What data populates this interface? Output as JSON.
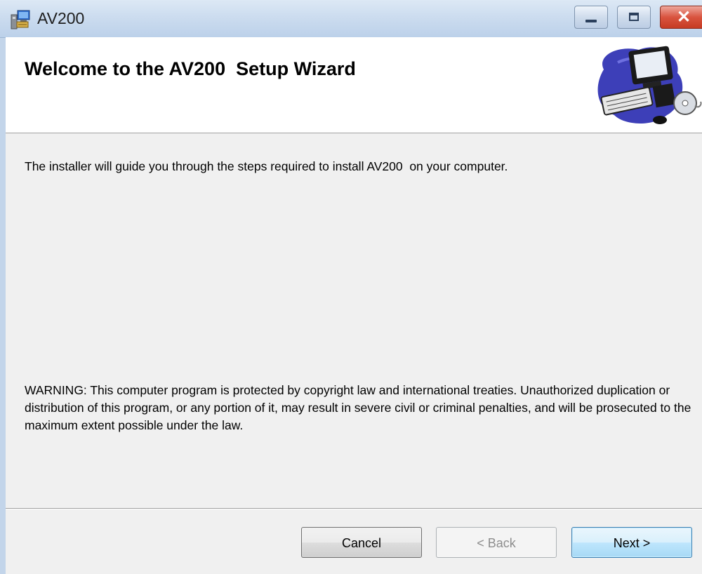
{
  "window": {
    "title": "AV200"
  },
  "title_controls": {
    "minimize": "minimize",
    "maximize": "maximize",
    "close": "close"
  },
  "banner": {
    "heading": "Welcome to the AV200  Setup Wizard"
  },
  "content": {
    "intro": "The installer will guide you through the steps required to install AV200  on your computer.",
    "warning": "WARNING: This computer program is protected by copyright law and international treaties. Unauthorized duplication or distribution of this program, or any portion of it, may result in severe civil or criminal penalties, and will be prosecuted to the maximum extent possible under the law."
  },
  "buttons": {
    "cancel": "Cancel",
    "back": "< Back",
    "next": "Next >"
  },
  "colors": {
    "accent_next": "#3c7fb1",
    "close_red": "#d9543f",
    "titlebar": "#c9daee"
  },
  "icons": [
    "installer-app-icon",
    "computer-clipart"
  ]
}
